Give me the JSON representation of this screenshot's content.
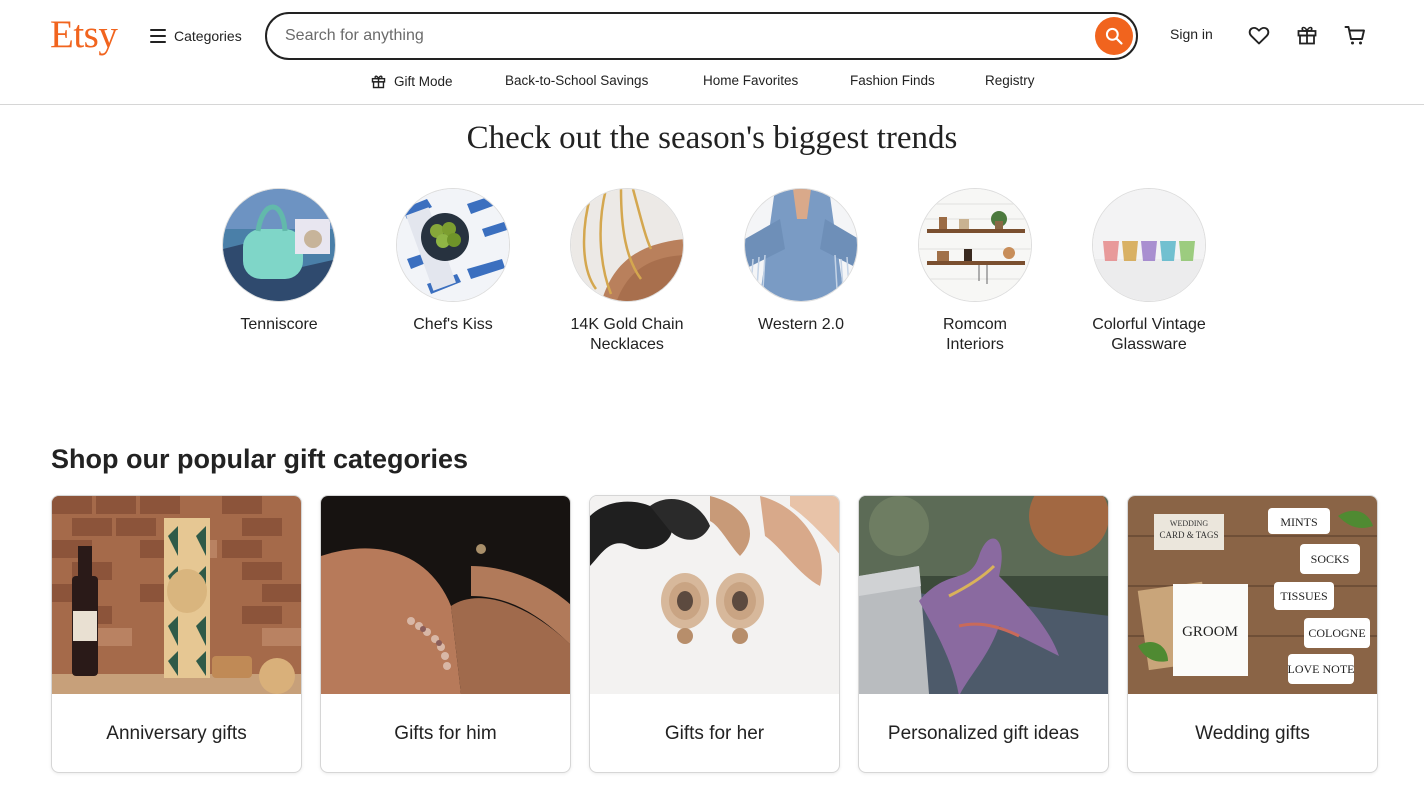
{
  "header": {
    "logo": "Etsy",
    "categories_label": "Categories",
    "search_placeholder": "Search for anything",
    "signin_label": "Sign in"
  },
  "subnav": [
    {
      "label": "Gift Mode",
      "icon": "gift-icon"
    },
    {
      "label": "Back-to-School Savings"
    },
    {
      "label": "Home Favorites"
    },
    {
      "label": "Fashion Finds"
    },
    {
      "label": "Registry"
    }
  ],
  "trends": {
    "title": "Check out the season's biggest trends",
    "items": [
      {
        "label": "Tenniscore"
      },
      {
        "label": "Chef's Kiss"
      },
      {
        "label": "14K Gold Chain Necklaces"
      },
      {
        "label": "Western 2.0"
      },
      {
        "label": "Romcom Interiors"
      },
      {
        "label": "Colorful Vintage Glassware"
      }
    ]
  },
  "gifts": {
    "title": "Shop our popular gift categories",
    "items": [
      {
        "label": "Anniversary gifts"
      },
      {
        "label": "Gifts for him"
      },
      {
        "label": "Gifts for her"
      },
      {
        "label": "Personalized gift ideas"
      },
      {
        "label": "Wedding gifts"
      }
    ]
  },
  "wedding_tags": {
    "card_line1": "WEDDING",
    "card_line2": "CARD & TAGS",
    "tags": [
      "MINTS",
      "SOCKS",
      "TISSUES",
      "COLOGNE",
      "LOVE NOTE"
    ],
    "card_word": "GROOM"
  },
  "colors": {
    "brand": "#f1641e",
    "text": "#222222",
    "border": "#d6d6d6"
  }
}
